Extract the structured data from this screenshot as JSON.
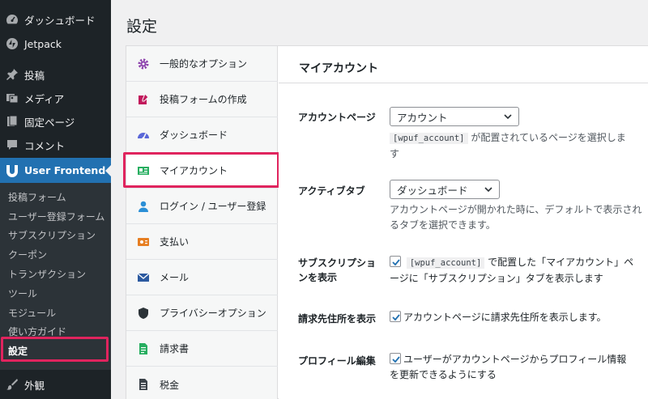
{
  "sidebar": {
    "items": [
      {
        "label": "ダッシュボード",
        "icon": "dashboard-icon"
      },
      {
        "label": "Jetpack",
        "icon": "jetpack-icon"
      },
      {
        "label": "投稿",
        "icon": "pin-icon"
      },
      {
        "label": "メディア",
        "icon": "media-icon"
      },
      {
        "label": "固定ページ",
        "icon": "page-icon"
      },
      {
        "label": "コメント",
        "icon": "comment-icon"
      },
      {
        "label": "User Frontend",
        "icon": "user-frontend-icon"
      },
      {
        "label": "外観",
        "icon": "appearance-icon"
      }
    ],
    "submenu": [
      "投稿フォーム",
      "ユーザー登録フォーム",
      "サブスクリプション",
      "クーポン",
      "トランザクション",
      "ツール",
      "モジュール",
      "使い方ガイド",
      "設定"
    ]
  },
  "page": {
    "title": "設定"
  },
  "settings_nav": [
    {
      "label": "一般的なオプション",
      "icon": "gear-icon"
    },
    {
      "label": "投稿フォームの作成",
      "icon": "edit-post-icon"
    },
    {
      "label": "ダッシュボード",
      "icon": "gauge-icon"
    },
    {
      "label": "マイアカウント",
      "icon": "id-card-icon"
    },
    {
      "label": "ログイン / ユーザー登録",
      "icon": "user-icon"
    },
    {
      "label": "支払い",
      "icon": "payment-icon"
    },
    {
      "label": "メール",
      "icon": "mail-icon"
    },
    {
      "label": "プライバシーオプション",
      "icon": "shield-icon"
    },
    {
      "label": "請求書",
      "icon": "invoice-icon"
    },
    {
      "label": "税金",
      "icon": "tax-icon"
    }
  ],
  "panel": {
    "title": "マイアカウント",
    "account_page": {
      "label": "アカウントページ",
      "value": "アカウント",
      "desc_code": "[wpuf_account]",
      "desc_line1": "が配置されているページを選択しま",
      "desc_line2": "す"
    },
    "active_tab": {
      "label": "アクティブタブ",
      "value": "ダッシュボード",
      "desc_line1": "アカウントページが開かれた時に、デフォルトで表示され",
      "desc_line2": "るタブを選択できます。"
    },
    "show_subscription": {
      "label_line1": "サブスクリプショ",
      "label_line2": "ンを表示",
      "checked": true,
      "code": "[wpuf_account]",
      "text_line1": "で配置した「マイアカウント」ペ",
      "text_line2": "ージに「サブスクリプション」タブを表示します"
    },
    "show_billing": {
      "label": "請求先住所を表示",
      "checked": true,
      "text": "アカウントページに請求先住所を表示します。"
    },
    "profile_edit": {
      "label": "プロフィール編集",
      "checked": true,
      "text_line1": "ユーザーがアカウントページからプロフィール情報",
      "text_line2": "を更新できるようにする"
    }
  },
  "colors": {
    "sidebar_bg": "#1d2327",
    "submenu_bg": "#2c3338",
    "accent": "#2271b1",
    "highlight": "#e0245e"
  }
}
